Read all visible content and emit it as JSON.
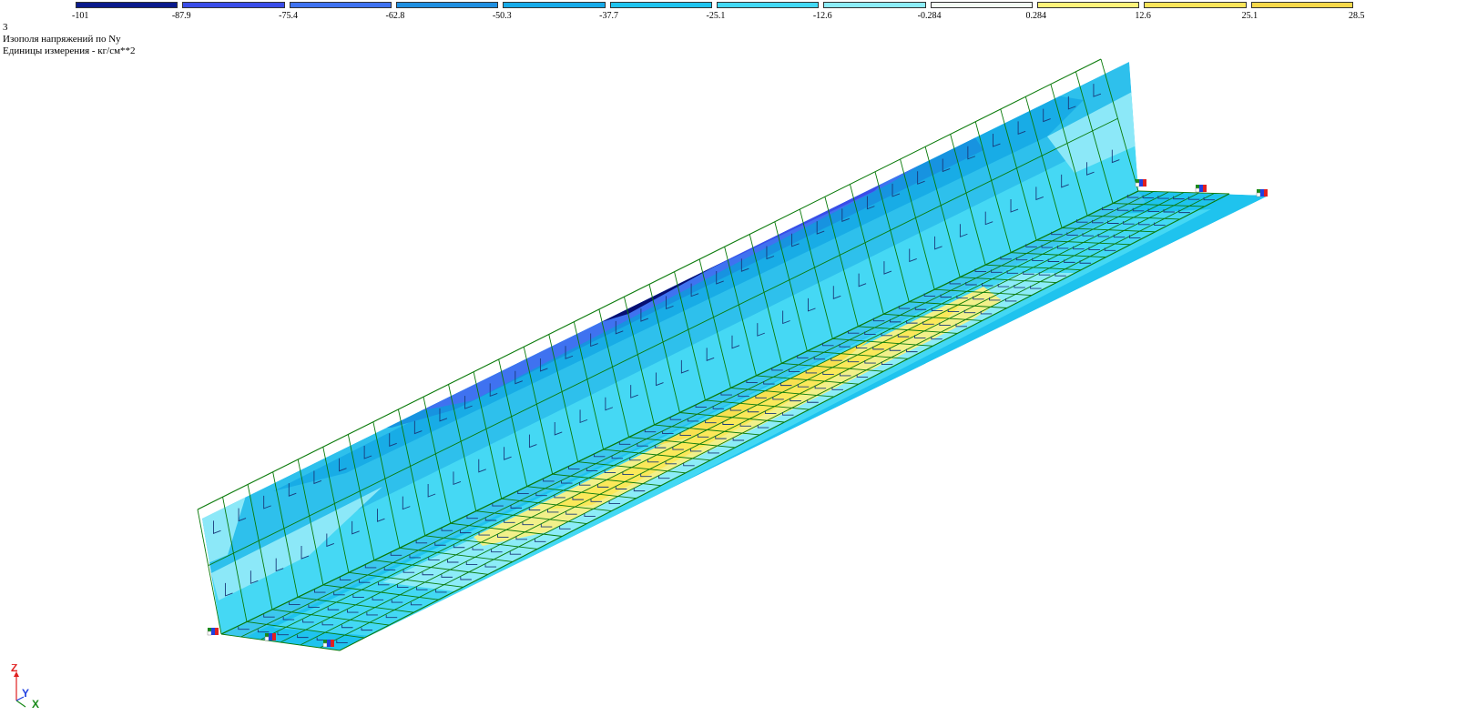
{
  "legend": {
    "ticks": [
      "-101",
      "-87.9",
      "-75.4",
      "-62.8",
      "-50.3",
      "-37.7",
      "-25.1",
      "-12.6",
      "-0.284",
      "0.284",
      "12.6",
      "25.1",
      "28.5"
    ],
    "colors": [
      "#0a1a8c",
      "#3a4de8",
      "#3f72f0",
      "#1f8fe0",
      "#17aae8",
      "#1fc3ee",
      "#43d8f4",
      "#8cecf8",
      "#f2fbf2",
      "#fff27a",
      "#fbe45a",
      "#f8d84a"
    ]
  },
  "info": {
    "case_number": "3",
    "title": "Изополя напряжений по Ny",
    "units": "Единицы измерения - кг/см**2"
  },
  "axes": {
    "z": "Z",
    "y": "Y",
    "x": "X"
  },
  "colors": {
    "mesh_line": "#0a7a0a",
    "wall_outline": "#1a7a1a"
  }
}
